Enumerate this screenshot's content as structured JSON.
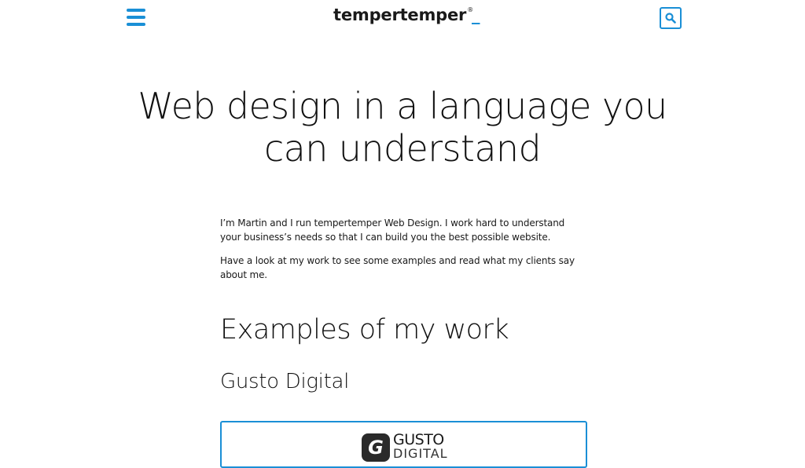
{
  "colors": {
    "accent": "#1a8fd6",
    "text": "#111111",
    "background": "#ffffff"
  },
  "header": {
    "menu_icon": "hamburger-menu-icon",
    "logo": {
      "text": "tempertemper",
      "mark": "®",
      "underscore": "_"
    },
    "search_icon": "search-icon"
  },
  "hero": {
    "title_line1": "Web design in a language you",
    "title_line2": "can understand"
  },
  "intro": {
    "paragraph1": "I’m Martin and I run tempertemper Web Design. I work hard to understand your business’s needs so that I can build you the best possible website.",
    "paragraph2": "Have a look at my work to see some examples and read what my clients say about me."
  },
  "work": {
    "section_title": "Examples of my work",
    "items": [
      {
        "title": "Gusto Digital",
        "logo_badge": "G",
        "logo_text_line1": "GUSTO",
        "logo_text_line2": "DIGITAL"
      }
    ]
  }
}
